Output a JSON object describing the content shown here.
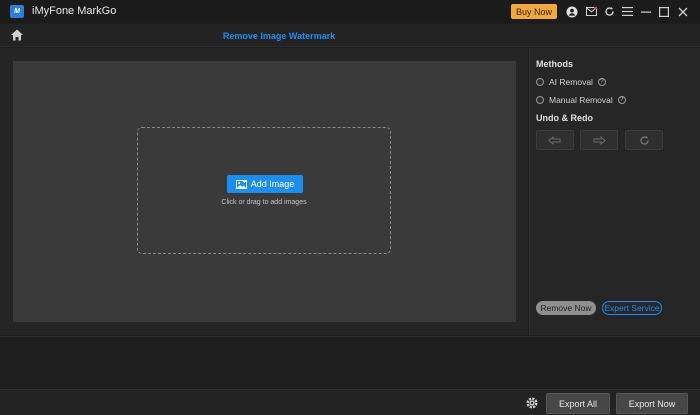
{
  "window": {
    "app_title": "iMyFone MarkGo",
    "buy_label": "Buy Now",
    "logo_text": "M",
    "icons": [
      "user-icon",
      "mail-icon",
      "refresh-icon",
      "menu-icon",
      "minimize-icon",
      "maximize-icon",
      "close-icon"
    ]
  },
  "header": {
    "title": "Remove Image Watermark"
  },
  "main": {
    "add_image_label": "Add Image",
    "hint": "Click or drag to add images"
  },
  "sidebar": {
    "methods_title": "Methods",
    "methods": [
      {
        "label": "AI Removal"
      },
      {
        "label": "Manual Removal"
      }
    ],
    "undo_redo_title": "Undo & Redo",
    "remove_now_label": "Remove Now",
    "expert_service_label": "Expert Service"
  },
  "footer": {
    "export_all_label": "Export All",
    "export_now_label": "Export Now"
  },
  "colors": {
    "accent": "#1c8ef0",
    "buy": "#f2a93b"
  }
}
